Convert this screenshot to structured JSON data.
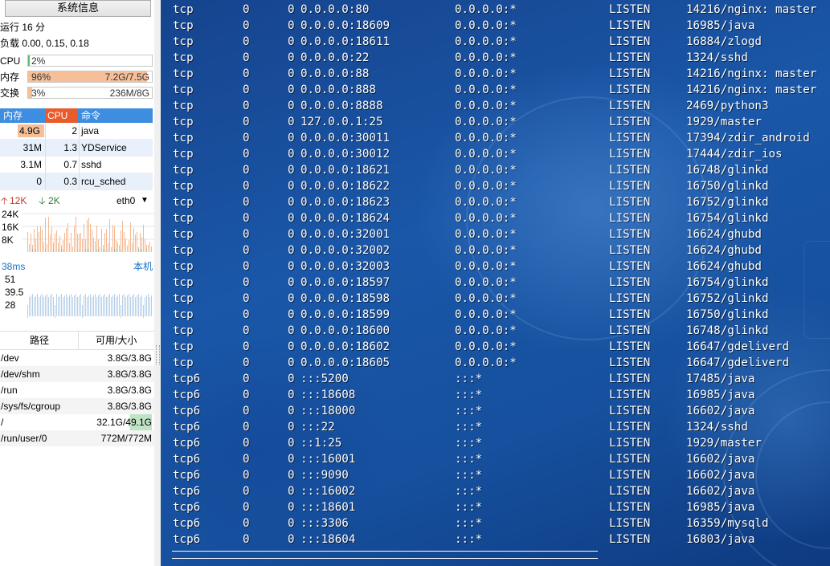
{
  "sidebar": {
    "sysinfo_button": "系统信息",
    "uptime": "运行 16 分",
    "load": "负载 0.00, 0.15, 0.18",
    "meters": [
      {
        "label": "CPU",
        "pct_text": "2%",
        "value": "",
        "fraction": 0.02,
        "color": "#9bd6a0"
      },
      {
        "label": "内存",
        "pct_text": "96%",
        "value": "7.2G/7.5G",
        "fraction": 0.96,
        "color": "#f6bf98"
      },
      {
        "label": "交换",
        "pct_text": "3%",
        "value": "236M/8G",
        "fraction": 0.03,
        "color": "#f6bf98"
      }
    ],
    "process_table": {
      "headers": [
        "内存",
        "CPU",
        "命令"
      ],
      "rows": [
        {
          "mem": "4.9G",
          "cpu": "2",
          "cmd": "java"
        },
        {
          "mem": "31M",
          "cpu": "1.3",
          "cmd": "YDService"
        },
        {
          "mem": "3.1M",
          "cpu": "0.7",
          "cmd": "sshd"
        },
        {
          "mem": "0",
          "cpu": "0.3",
          "cmd": "rcu_sched"
        }
      ]
    },
    "network": {
      "up": "12K",
      "down": "2K",
      "interface": "eth0",
      "y_labels": [
        "24K",
        "16K",
        "8K"
      ]
    },
    "latency": {
      "value": "38ms",
      "host": "本机",
      "y_labels": [
        "51",
        "39.5",
        "28"
      ]
    },
    "filesystems": {
      "headers": [
        "路径",
        "可用/大小"
      ],
      "rows": [
        {
          "path": "/dev",
          "size": "3.8G/3.8G"
        },
        {
          "path": "/dev/shm",
          "size": "3.8G/3.8G"
        },
        {
          "path": "/run",
          "size": "3.8G/3.8G"
        },
        {
          "path": "/sys/fs/cgroup",
          "size": "3.8G/3.8G"
        },
        {
          "path": "/",
          "size": "32.1G/49.1G"
        },
        {
          "path": "/run/user/0",
          "size": "772M/772M"
        }
      ]
    }
  },
  "terminal": {
    "rows": [
      [
        "tcp",
        "0",
        "0",
        "0.0.0.0:80",
        "0.0.0.0:*",
        "LISTEN",
        "14216/nginx: master"
      ],
      [
        "tcp",
        "0",
        "0",
        "0.0.0.0:18609",
        "0.0.0.0:*",
        "LISTEN",
        "16985/java"
      ],
      [
        "tcp",
        "0",
        "0",
        "0.0.0.0:18611",
        "0.0.0.0:*",
        "LISTEN",
        "16884/zlogd"
      ],
      [
        "tcp",
        "0",
        "0",
        "0.0.0.0:22",
        "0.0.0.0:*",
        "LISTEN",
        "1324/sshd"
      ],
      [
        "tcp",
        "0",
        "0",
        "0.0.0.0:88",
        "0.0.0.0:*",
        "LISTEN",
        "14216/nginx: master"
      ],
      [
        "tcp",
        "0",
        "0",
        "0.0.0.0:888",
        "0.0.0.0:*",
        "LISTEN",
        "14216/nginx: master"
      ],
      [
        "tcp",
        "0",
        "0",
        "0.0.0.0:8888",
        "0.0.0.0:*",
        "LISTEN",
        "2469/python3"
      ],
      [
        "tcp",
        "0",
        "0",
        "127.0.0.1:25",
        "0.0.0.0:*",
        "LISTEN",
        "1929/master"
      ],
      [
        "tcp",
        "0",
        "0",
        "0.0.0.0:30011",
        "0.0.0.0:*",
        "LISTEN",
        "17394/zdir_android"
      ],
      [
        "tcp",
        "0",
        "0",
        "0.0.0.0:30012",
        "0.0.0.0:*",
        "LISTEN",
        "17444/zdir_ios"
      ],
      [
        "tcp",
        "0",
        "0",
        "0.0.0.0:18621",
        "0.0.0.0:*",
        "LISTEN",
        "16748/glinkd"
      ],
      [
        "tcp",
        "0",
        "0",
        "0.0.0.0:18622",
        "0.0.0.0:*",
        "LISTEN",
        "16750/glinkd"
      ],
      [
        "tcp",
        "0",
        "0",
        "0.0.0.0:18623",
        "0.0.0.0:*",
        "LISTEN",
        "16752/glinkd"
      ],
      [
        "tcp",
        "0",
        "0",
        "0.0.0.0:18624",
        "0.0.0.0:*",
        "LISTEN",
        "16754/glinkd"
      ],
      [
        "tcp",
        "0",
        "0",
        "0.0.0.0:32001",
        "0.0.0.0:*",
        "LISTEN",
        "16624/ghubd"
      ],
      [
        "tcp",
        "0",
        "0",
        "0.0.0.0:32002",
        "0.0.0.0:*",
        "LISTEN",
        "16624/ghubd"
      ],
      [
        "tcp",
        "0",
        "0",
        "0.0.0.0:32003",
        "0.0.0.0:*",
        "LISTEN",
        "16624/ghubd"
      ],
      [
        "tcp",
        "0",
        "0",
        "0.0.0.0:18597",
        "0.0.0.0:*",
        "LISTEN",
        "16754/glinkd"
      ],
      [
        "tcp",
        "0",
        "0",
        "0.0.0.0:18598",
        "0.0.0.0:*",
        "LISTEN",
        "16752/glinkd"
      ],
      [
        "tcp",
        "0",
        "0",
        "0.0.0.0:18599",
        "0.0.0.0:*",
        "LISTEN",
        "16750/glinkd"
      ],
      [
        "tcp",
        "0",
        "0",
        "0.0.0.0:18600",
        "0.0.0.0:*",
        "LISTEN",
        "16748/glinkd"
      ],
      [
        "tcp",
        "0",
        "0",
        "0.0.0.0:18602",
        "0.0.0.0:*",
        "LISTEN",
        "16647/gdeliverd"
      ],
      [
        "tcp",
        "0",
        "0",
        "0.0.0.0:18605",
        "0.0.0.0:*",
        "LISTEN",
        "16647/gdeliverd"
      ],
      [
        "tcp6",
        "0",
        "0",
        ":::5200",
        ":::*",
        "LISTEN",
        "17485/java"
      ],
      [
        "tcp6",
        "0",
        "0",
        ":::18608",
        ":::*",
        "LISTEN",
        "16985/java"
      ],
      [
        "tcp6",
        "0",
        "0",
        ":::18000",
        ":::*",
        "LISTEN",
        "16602/java"
      ],
      [
        "tcp6",
        "0",
        "0",
        ":::22",
        ":::*",
        "LISTEN",
        "1324/sshd"
      ],
      [
        "tcp6",
        "0",
        "0",
        "::1:25",
        ":::*",
        "LISTEN",
        "1929/master"
      ],
      [
        "tcp6",
        "0",
        "0",
        ":::16001",
        ":::*",
        "LISTEN",
        "16602/java"
      ],
      [
        "tcp6",
        "0",
        "0",
        ":::9090",
        ":::*",
        "LISTEN",
        "16602/java"
      ],
      [
        "tcp6",
        "0",
        "0",
        ":::16002",
        ":::*",
        "LISTEN",
        "16602/java"
      ],
      [
        "tcp6",
        "0",
        "0",
        ":::18601",
        ":::*",
        "LISTEN",
        "16985/java"
      ],
      [
        "tcp6",
        "0",
        "0",
        ":::3306",
        ":::*",
        "LISTEN",
        "16359/mysqld"
      ],
      [
        "tcp6",
        "0",
        "0",
        ":::18604",
        ":::*",
        "LISTEN",
        "16803/java"
      ]
    ]
  }
}
